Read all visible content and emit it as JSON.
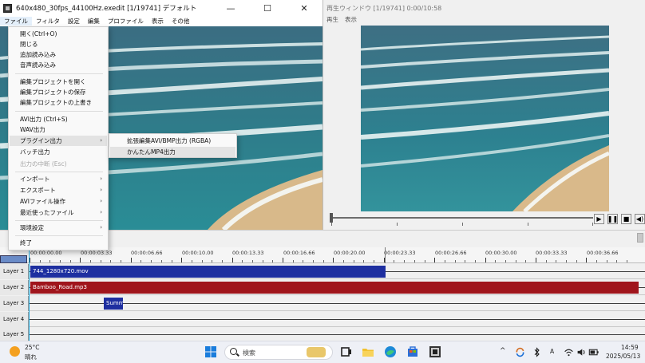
{
  "main_window": {
    "title": "640x480_30fps_44100Hz.exedit  [1/19741]  デフォルト",
    "controls": {
      "minimize": "—",
      "maximize": "☐",
      "close": "✕"
    },
    "menu": [
      "ファイル",
      "フィルタ",
      "設定",
      "編集",
      "プロファイル",
      "表示",
      "その他"
    ]
  },
  "file_menu": {
    "items": [
      {
        "label": "開く(Ctrl+O)"
      },
      {
        "label": "閉じる"
      },
      {
        "label": "追加読み込み"
      },
      {
        "label": "音声読み込み"
      },
      {
        "label": "編集プロジェクトを開く"
      },
      {
        "label": "編集プロジェクトの保存"
      },
      {
        "label": "編集プロジェクトの上書き"
      },
      {
        "label": "AVI出力 (Ctrl+S)"
      },
      {
        "label": "WAV出力"
      },
      {
        "label": "プラグイン出力",
        "submenu": true,
        "hover": true
      },
      {
        "label": "バッチ出力"
      },
      {
        "label": "出力の中断 (Esc)",
        "disabled": true
      },
      {
        "label": "インポート",
        "submenu": true
      },
      {
        "label": "エクスポート",
        "submenu": true
      },
      {
        "label": "AVIファイル操作",
        "submenu": true
      },
      {
        "label": "最近使ったファイル",
        "submenu": true
      },
      {
        "label": "環境設定",
        "submenu": true
      },
      {
        "label": "終了"
      }
    ]
  },
  "plugin_submenu": {
    "items": [
      {
        "label": "拡張編集AVI/BMP出力 (RGBA)"
      },
      {
        "label": "かんたんMP4出力",
        "hover": true
      }
    ]
  },
  "playback_window": {
    "title": "再生ウィンドウ  [1/19741]  0:00/10:58",
    "menu": [
      "再生",
      "表示"
    ],
    "buttons": {
      "play": "▶",
      "pause": "❚❚",
      "stop": "■",
      "volume": "◀)"
    }
  },
  "timeline": {
    "ruler": [
      "00:00:00.00",
      "00:00:03.33",
      "00:00:06.66",
      "00:00:10.00",
      "00:00:13.33",
      "00:00:16.66",
      "00:00:20.00",
      "00:00:23.33",
      "00:00:26.66",
      "00:00:30.00",
      "00:00:33.33",
      "00:00:36.66"
    ],
    "layers": [
      "Layer 1",
      "Layer 2",
      "Layer 3",
      "Layer 4",
      "Layer 5"
    ],
    "clips": [
      {
        "layer": 1,
        "label": "744_1280x720.mov",
        "color": "#1e2fa0"
      },
      {
        "layer": 2,
        "label": "Bamboo_Road.mp3",
        "color": "#a0151c"
      },
      {
        "layer": 3,
        "label": "Summ",
        "color": "#1e2fa0"
      }
    ]
  },
  "taskbar": {
    "weather": {
      "temp": "25°C",
      "desc": "晴れ"
    },
    "search_placeholder": "検索",
    "tray": {
      "ime": "A"
    },
    "clock": {
      "time": "14:59",
      "date": "2025/05/13"
    }
  }
}
